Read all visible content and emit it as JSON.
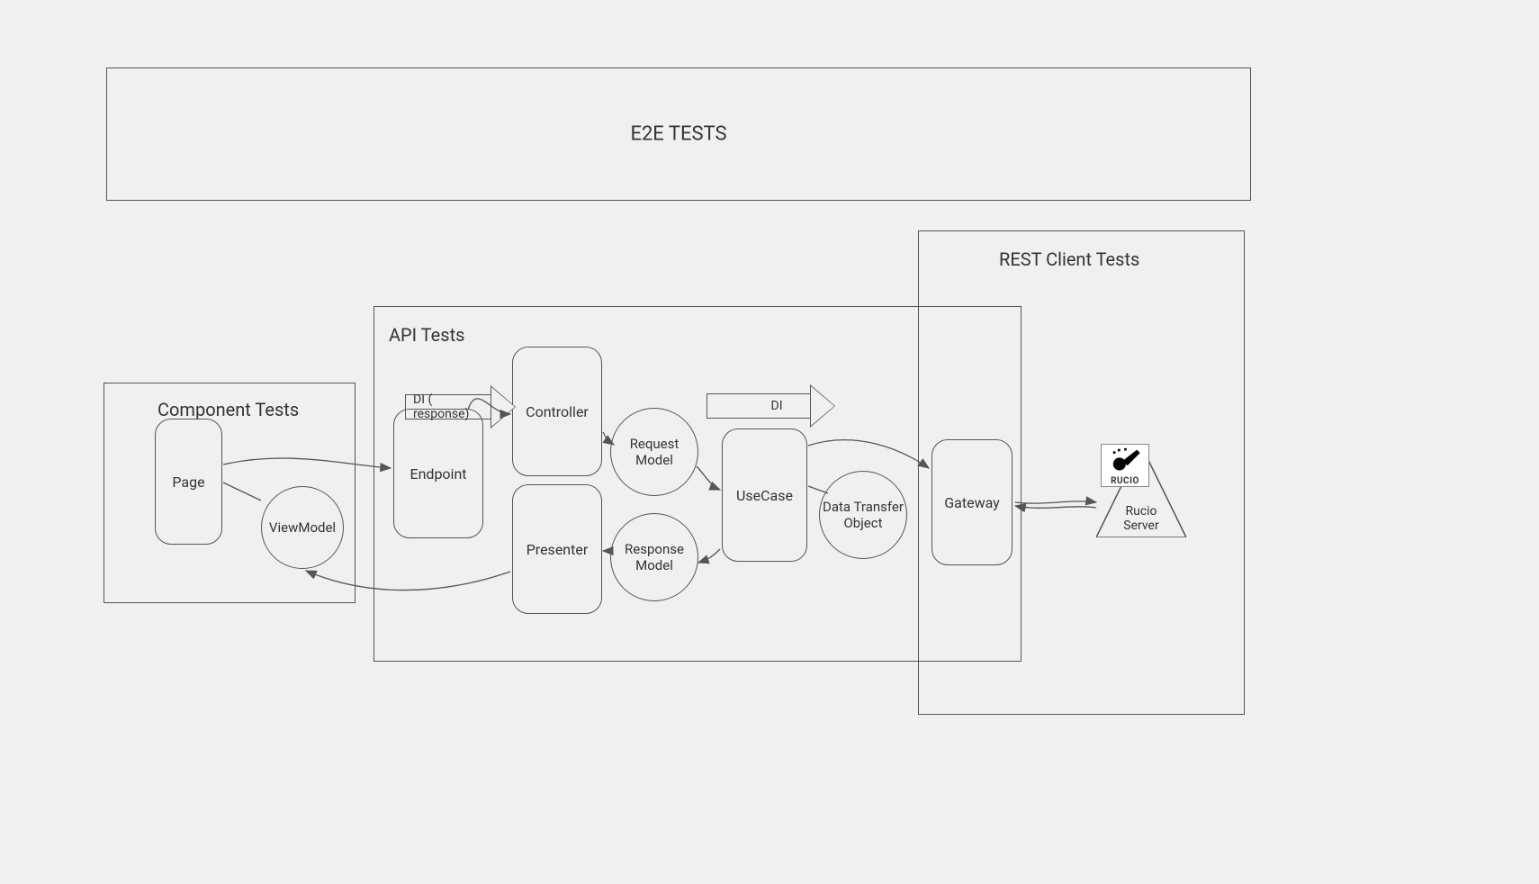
{
  "containers": {
    "e2e": {
      "label": "E2E TESTS"
    },
    "component": {
      "label": "Component Tests"
    },
    "api": {
      "label": "API Tests"
    },
    "rest": {
      "label": "REST Client Tests"
    }
  },
  "nodes": {
    "page": "Page",
    "viewmodel": "ViewModel",
    "endpoint": "Endpoint",
    "controller": "Controller",
    "presenter": "Presenter",
    "requestModel": "Request Model",
    "responseModel": "Response Model",
    "usecase": "UseCase",
    "dto": "Data Transfer Object",
    "gateway": "Gateway",
    "rucioServer": "Rucio\nServer",
    "rucioLogoText": "RUCIO"
  },
  "arrows": {
    "diResponse": "DI ( response)",
    "di": "DI"
  }
}
